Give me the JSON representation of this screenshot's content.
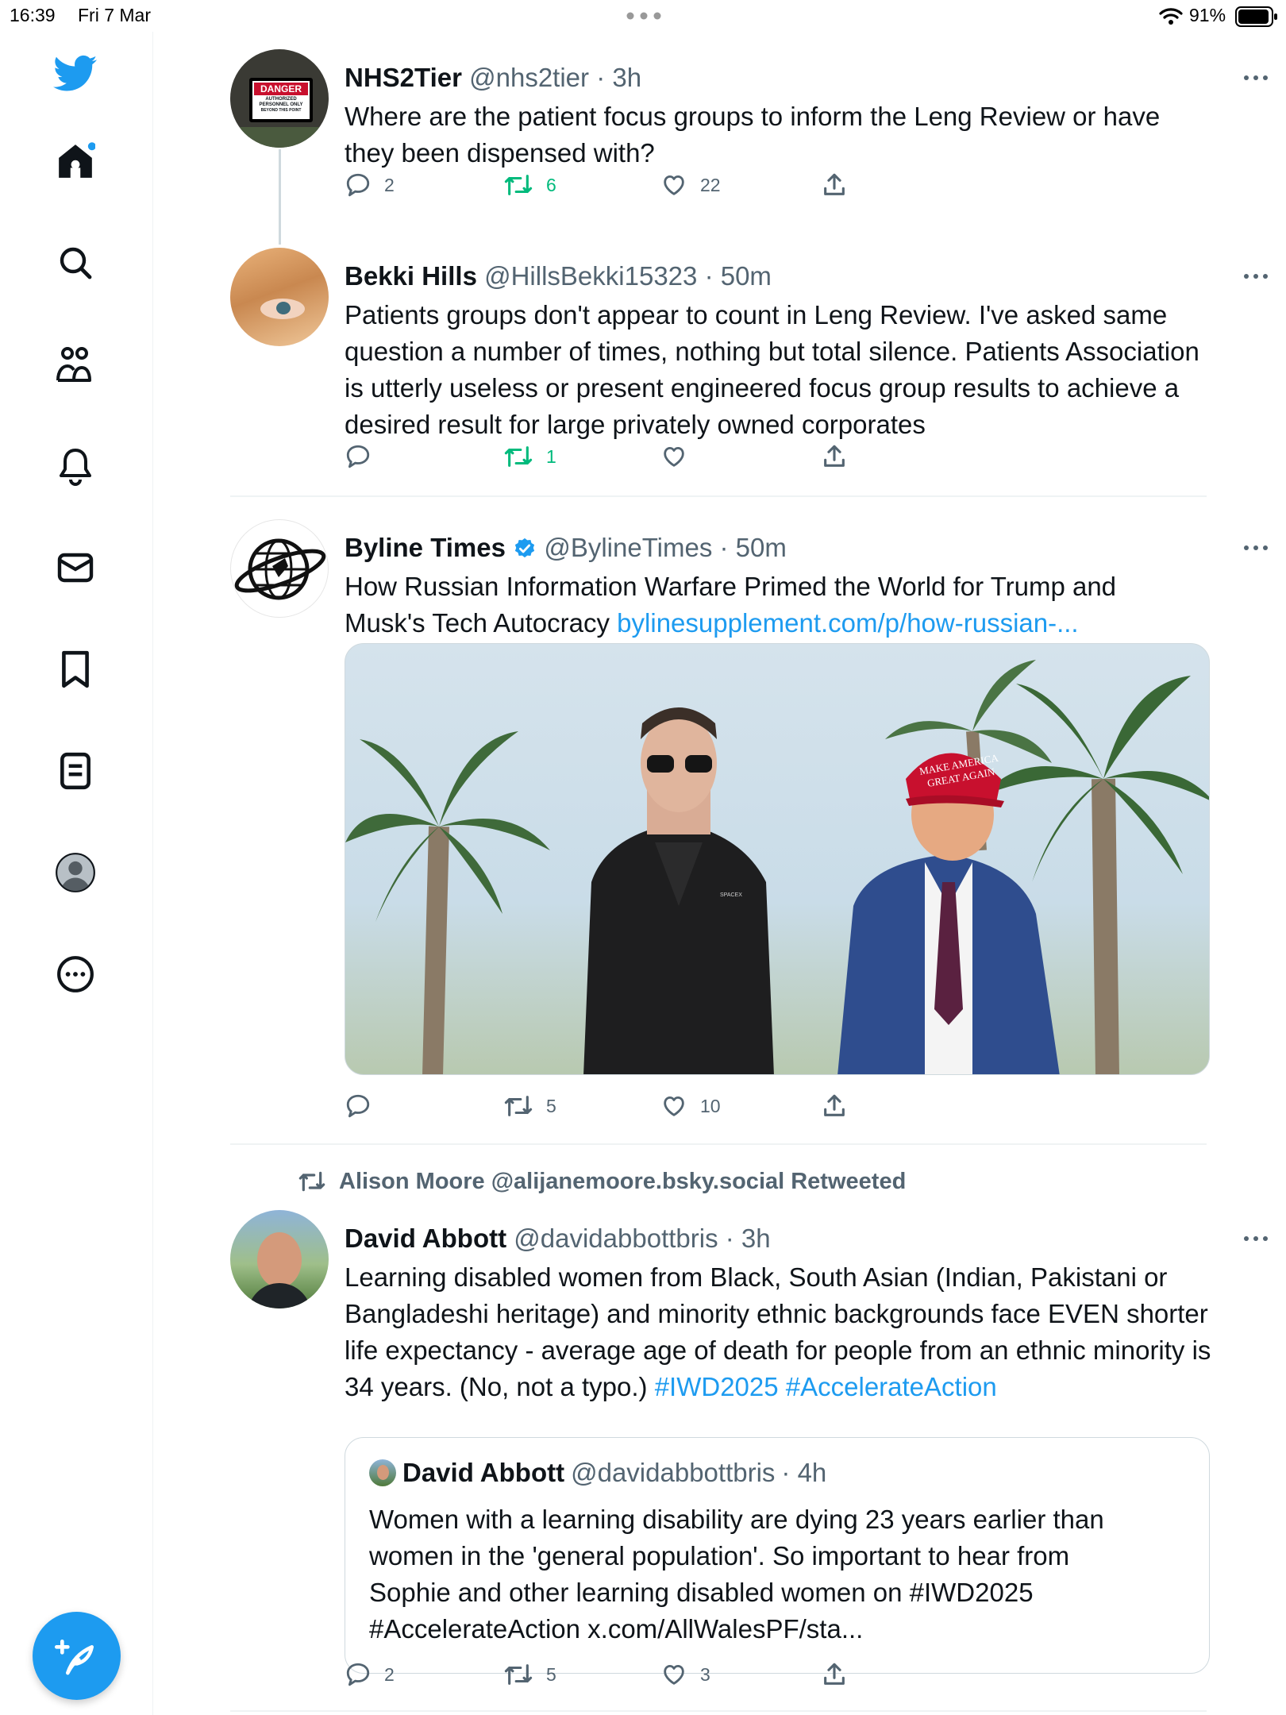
{
  "status_bar": {
    "time": "16:39",
    "date": "Fri 7 Mar",
    "battery": "91%"
  },
  "nav": {
    "items": [
      "twitter-logo",
      "home",
      "search",
      "communities",
      "notifications",
      "messages",
      "bookmarks",
      "lists",
      "profile",
      "more"
    ]
  },
  "tweets": [
    {
      "name": "NHS2Tier",
      "handle": "@nhs2tier",
      "time": "· 3h",
      "avatar_sign": {
        "top": "DANGER",
        "line1": "AUTHORIZED",
        "line2": "PERSONNEL ONLY",
        "line3": "BEYOND THIS POINT"
      },
      "text": "Where are the patient focus groups to inform the Leng Review or have they been dispensed with?",
      "replies": "2",
      "retweets": "6",
      "likes": "22"
    },
    {
      "name": "Bekki Hills",
      "handle": "@HillsBekki15323",
      "time": "· 50m",
      "text": "Patients groups don't appear to count in Leng Review. I've asked same question a number of times, nothing but total silence. Patients Association is utterly useless or present engineered focus group results to  achieve a desired result for large privately owned corporates",
      "replies": "",
      "retweets": "1",
      "likes": ""
    },
    {
      "name": "Byline Times",
      "handle": "@BylineTimes",
      "time": "· 50m",
      "text": "How Russian Information Warfare Primed the World for Trump and Musk's Tech Autocracy ",
      "link": "bylinesupplement.com/p/how-russian-...",
      "image_caption": {
        "hat_line1": "MAKE AMERICA",
        "hat_line2": "GREAT AGAIN",
        "shirt": "SPACEX"
      },
      "replies": "",
      "retweets": "5",
      "likes": "10"
    },
    {
      "retweeted_by": "Alison Moore @alijanemoore.bsky.social Retweeted",
      "name": "David Abbott",
      "handle": "@davidabbottbris",
      "time": "· 3h",
      "text": "Learning disabled women from Black, South Asian (Indian, Pakistani or Bangladeshi heritage) and minority ethnic backgrounds face EVEN shorter life expectancy - average age of death for people from an ethnic minority is 34 years. (No, not a typo.) ",
      "hashtags": "#IWD2025 #AccelerateAction",
      "quote": {
        "name": "David Abbott",
        "handle": "@davidabbottbris",
        "time": "· 4h",
        "text": "Women with a learning disability are dying 23 years earlier than women in the 'general population'. So important to hear from Sophie and other learning disabled women on #IWD2025 #AccelerateAction x.com/AllWalesPF/sta..."
      },
      "replies": "2",
      "retweets": "5",
      "likes": "3"
    }
  ],
  "colors": {
    "accent": "#1d9bf0",
    "retweet": "#00ba7c",
    "secondary": "#536471",
    "divider": "#eff3f4"
  }
}
